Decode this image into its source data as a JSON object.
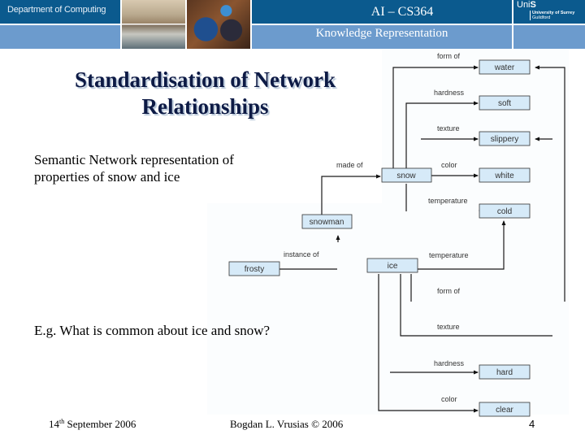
{
  "header": {
    "department": "Department of Computing",
    "course": "AI – CS364",
    "subject": "Knowledge Representation",
    "university_mark_prefix": "Uni",
    "university_mark_suffix": "S",
    "university_name": "University of Surrey",
    "university_place": "Guildford",
    "colors": {
      "dark_band": "#0b5a8e",
      "light_band": "#6c9bcd"
    }
  },
  "slide": {
    "title_line1": "Standardisation of Network",
    "title_line2": "Relationships",
    "intro": "Semantic Network representation of properties of snow and ice",
    "question": "E.g. What is common about ice and snow?"
  },
  "diagram": {
    "node_fill": "#d6eaf8",
    "nodes": {
      "water": "water",
      "soft": "soft",
      "slippery": "slippery",
      "snow": "snow",
      "white": "white",
      "cold": "cold",
      "snowman": "snowman",
      "frosty": "frosty",
      "ice": "ice",
      "hard": "hard",
      "clear": "clear"
    },
    "edge_labels": {
      "snow_form_of": "form of",
      "snow_hardness": "hardness",
      "snow_texture": "texture",
      "snowman_made_of": "made of",
      "snow_color": "color",
      "snow_temperature": "temperature",
      "frosty_instance_of": "instance of",
      "ice_temperature": "temperature",
      "ice_form_of": "form of",
      "ice_texture": "texture",
      "ice_hardness": "hardness",
      "ice_color": "color"
    }
  },
  "footer": {
    "date_day": "14",
    "date_suffix": "th",
    "date_rest": " September 2006",
    "author": "Bogdan L. Vrusias © 2006",
    "page": "4"
  }
}
